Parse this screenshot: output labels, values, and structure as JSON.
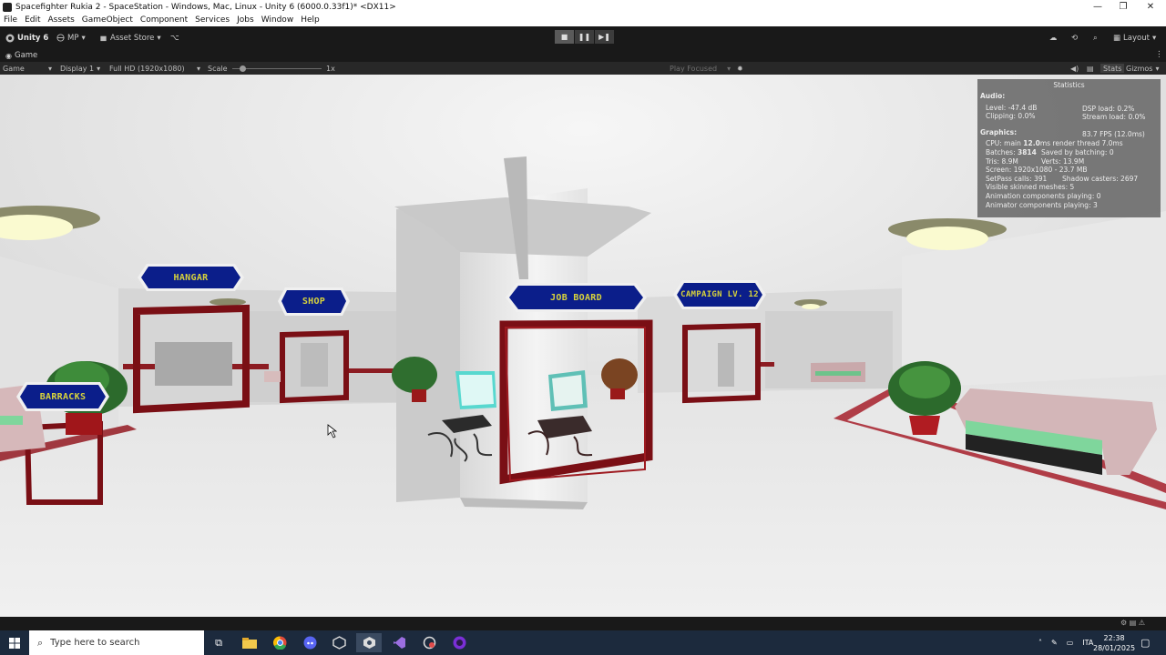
{
  "window": {
    "title": "Spacefighter Rukia 2 - SpaceStation - Windows, Mac, Linux - Unity 6 (6000.0.33f1)* <DX11>",
    "controls": [
      "—",
      "❐",
      "✕"
    ]
  },
  "menu": [
    "File",
    "Edit",
    "Assets",
    "GameObject",
    "Component",
    "Services",
    "Jobs",
    "Window",
    "Help"
  ],
  "toolbar": {
    "unity_label": "Unity 6",
    "mp_label": "MP",
    "asset_store_label": "Asset Store",
    "layout_label": "Layout"
  },
  "tab": {
    "label": "Game"
  },
  "gamebar": {
    "mode": "Game",
    "display": "Display 1",
    "resolution": "Full HD (1920x1080)",
    "scale_label": "Scale",
    "scale_value": "1x",
    "play_focused": "Play Focused",
    "stats": "Stats",
    "gizmos": "Gizmos"
  },
  "signs": {
    "hangar": "HANGAR",
    "shop": "SHOP",
    "job_board": "JOB BOARD",
    "campaign": "CAMPAIGN LV. 12",
    "barracks": "BARRACKS"
  },
  "statistics": {
    "title": "Statistics",
    "audio_header": "Audio:",
    "level": "Level: -47.4 dB",
    "clipping": "Clipping: 0.0%",
    "dsp_load": "DSP load: 0.2%",
    "stream_load": "Stream load: 0.0%",
    "graphics_header": "Graphics:",
    "fps": "83.7 FPS (12.0ms)",
    "cpu_prefix": "CPU: main ",
    "cpu_main": "12.0",
    "cpu_suffix": "ms  render thread 7.0ms",
    "batches_prefix": "Batches: ",
    "batches": "3814",
    "saved_batching": "Saved by batching: 0",
    "tris": "Tris: 8.9M",
    "verts": "Verts: 13.9M",
    "screen": "Screen: 1920x1080 - 23.7 MB",
    "setpass": "SetPass calls: 391",
    "shadow_casters": "Shadow casters: 2697",
    "skinned": "Visible skinned meshes: 5",
    "animation": "Animation components playing: 0",
    "animator": "Animator components playing: 3"
  },
  "taskbar": {
    "search_placeholder": "Type here to search",
    "lang": "ITA",
    "time": "22:38",
    "date": "28/01/2025"
  }
}
